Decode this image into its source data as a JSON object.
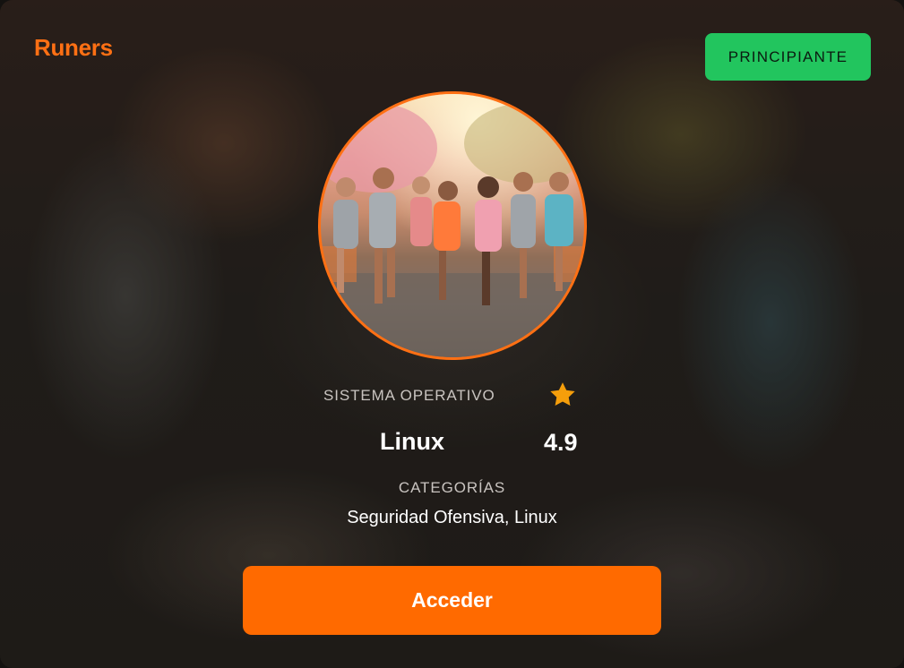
{
  "header": {
    "brand": "Runers",
    "level_badge": "PRINCIPIANTE"
  },
  "details": {
    "os_label": "SISTEMA OPERATIVO",
    "os_value": "Linux",
    "rating": "4.9",
    "categories_label": "CATEGORÍAS",
    "categories_value": "Seguridad Ofensiva, Linux"
  },
  "actions": {
    "access_label": "Acceder"
  },
  "icons": {
    "rating": "star-icon"
  },
  "colors": {
    "accent": "#ff7014",
    "button": "#ff6a00",
    "badge": "#22c55e",
    "star": "#f59e0b"
  }
}
